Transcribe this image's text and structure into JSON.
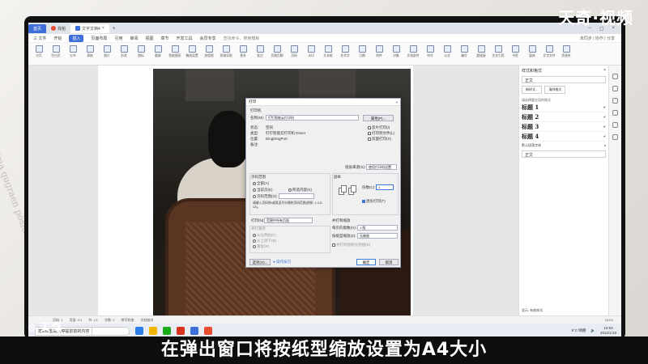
{
  "watermark": {
    "top_right": "天奇·视频",
    "bottom_left": "天奇"
  },
  "caption": "在弹出窗口将按纸型缩放设置为A4大小",
  "desk_deco": "Aima qugraen positio",
  "tabs": [
    {
      "label": "首页",
      "kind": "home"
    },
    {
      "label": "找稻",
      "kind": "normal"
    },
    {
      "label": "文字文档4",
      "kind": "active"
    }
  ],
  "menu": {
    "items": [
      "三 文件",
      "开始",
      "插入",
      "页面布局",
      "引用",
      "审阅",
      "视图",
      "章节",
      "开发工具",
      "会员专享",
      "查找命令、搜索模板"
    ],
    "selected_index": 2,
    "right": "未同步 | 协作 | 分享"
  },
  "ribbon": [
    "分页",
    "空白页",
    "分节",
    "表格",
    "图片",
    "形状",
    "图标",
    "截屏",
    "智能图形",
    "稿纸设置",
    "流程图",
    "思维导图",
    "更多",
    "批注",
    "页眉页脚",
    "页码",
    "水印",
    "文本框",
    "艺术字",
    "日期",
    "附件",
    "对象",
    "文档部件",
    "符号",
    "公式",
    "编号",
    "超链接",
    "交叉引用",
    "书签",
    "窗体",
    "文字文件",
    "资源夹"
  ],
  "dialog": {
    "title": "打印",
    "printer_section": "打印机",
    "name_label": "名称(M):",
    "name_value": "钉钉智能云打印机",
    "properties_btn": "属性(P)...",
    "status_label": "状态:",
    "status_value": "空闲",
    "type_label": "类型:",
    "type_value": "钉钉智能云打印机 Driver",
    "where_label": "位置:",
    "where_value": "DingDingPort",
    "comment_label": "备注:",
    "comment_value": "",
    "cb_reverse": "反片打印(I)",
    "cb_file": "打印到文件(L)",
    "cb_duplex": "双面打印(X)",
    "paper_source_label": "纸张来源(S):",
    "paper_source_value": "使用打印机设置",
    "range_section": "页码范围",
    "range_all": "全部(A)",
    "range_current": "当前页(E)",
    "range_selection": "所选内容(S)",
    "range_pages": "页码范围(G):",
    "range_hint": "请键入页码和/或用逗号分隔的页码范围(例如: 1,3,5-12)。",
    "copies_section": "副本",
    "copies_label": "份数(C):",
    "copies_value": "1",
    "collate": "逐份打印(T)",
    "print_label": "打印(N):",
    "print_value": "范围中所有页面",
    "order_section": "并打顺序",
    "order_lr": "从左到右(F)",
    "order_tb": "从上到下(B)",
    "order_rep": "重复(R)",
    "zoom_section": "并打和缩放",
    "per_sheet_label": "每页的版数(H):",
    "per_sheet_value": "1 版",
    "scale_label": "按纸型缩放(Z):",
    "scale_value": "无缩放",
    "scale_cb": "并打时绘制分割线(D)",
    "options_btn": "选项(O)...",
    "tips_link": "操作技巧",
    "ok_btn": "确定",
    "cancel_btn": "取消"
  },
  "right_pane": {
    "title": "样式和格式",
    "current": "正文",
    "new_btn": "新样式...",
    "clear_btn": "清除格式",
    "apply_label": "请选择要应用的格式",
    "styles": [
      "标题 1",
      "标题 2",
      "标题 3",
      "标题 4"
    ],
    "default_font": "默认段落字体",
    "body": "正文",
    "show_label": "显示: 有效样式",
    "preview_label": "显示预览"
  },
  "statusbar": {
    "items": [
      "页码: 1",
      "页面: 1/1",
      "节: 1/1",
      "字数: 0",
      "拼写检查",
      "文档校对"
    ],
    "zoom": "161%"
  },
  "taskbar": {
    "notice": "按Esc键输入停提前前的内容",
    "search": "搜索",
    "weather": "9°C 晴朗",
    "time": "10:53",
    "date": "2022/1/19"
  }
}
